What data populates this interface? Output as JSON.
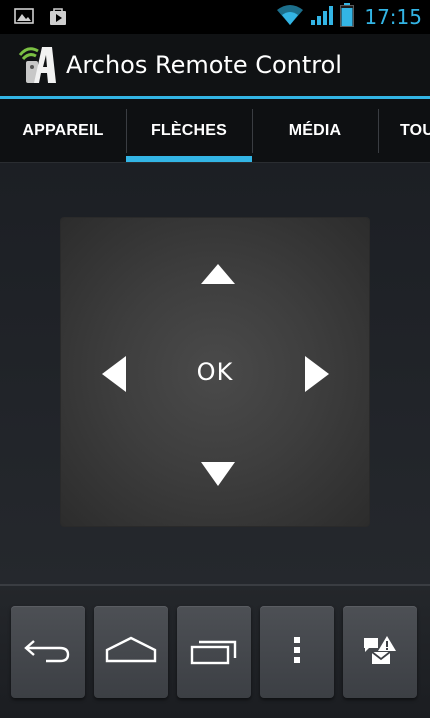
{
  "status_bar": {
    "time": "17:15",
    "icons": [
      "image-notification-icon",
      "play-store-notification-icon",
      "wifi-icon",
      "signal-icon",
      "battery-icon"
    ]
  },
  "action_bar": {
    "title": "Archos Remote Control",
    "icon": "archos-app-icon"
  },
  "tabs": [
    {
      "label": "APPAREIL",
      "active": false
    },
    {
      "label": "FLÈCHES",
      "active": true
    },
    {
      "label": "MÉDIA",
      "active": false
    },
    {
      "label": "TOU",
      "active": false
    }
  ],
  "dpad": {
    "center_label": "OK",
    "arrows": [
      "up-arrow-icon",
      "left-arrow-icon",
      "right-arrow-icon",
      "down-arrow-icon"
    ]
  },
  "bottom_buttons": [
    {
      "name": "back-button",
      "icon": "back-icon"
    },
    {
      "name": "home-button",
      "icon": "home-icon"
    },
    {
      "name": "recent-apps-button",
      "icon": "recent-apps-icon"
    },
    {
      "name": "menu-button",
      "icon": "overflow-menu-icon"
    },
    {
      "name": "notifications-button",
      "icon": "messages-alert-icon"
    }
  ],
  "colors": {
    "accent": "#33b5e5",
    "background": "#1f2227",
    "dpad": "#3e3e3e"
  }
}
